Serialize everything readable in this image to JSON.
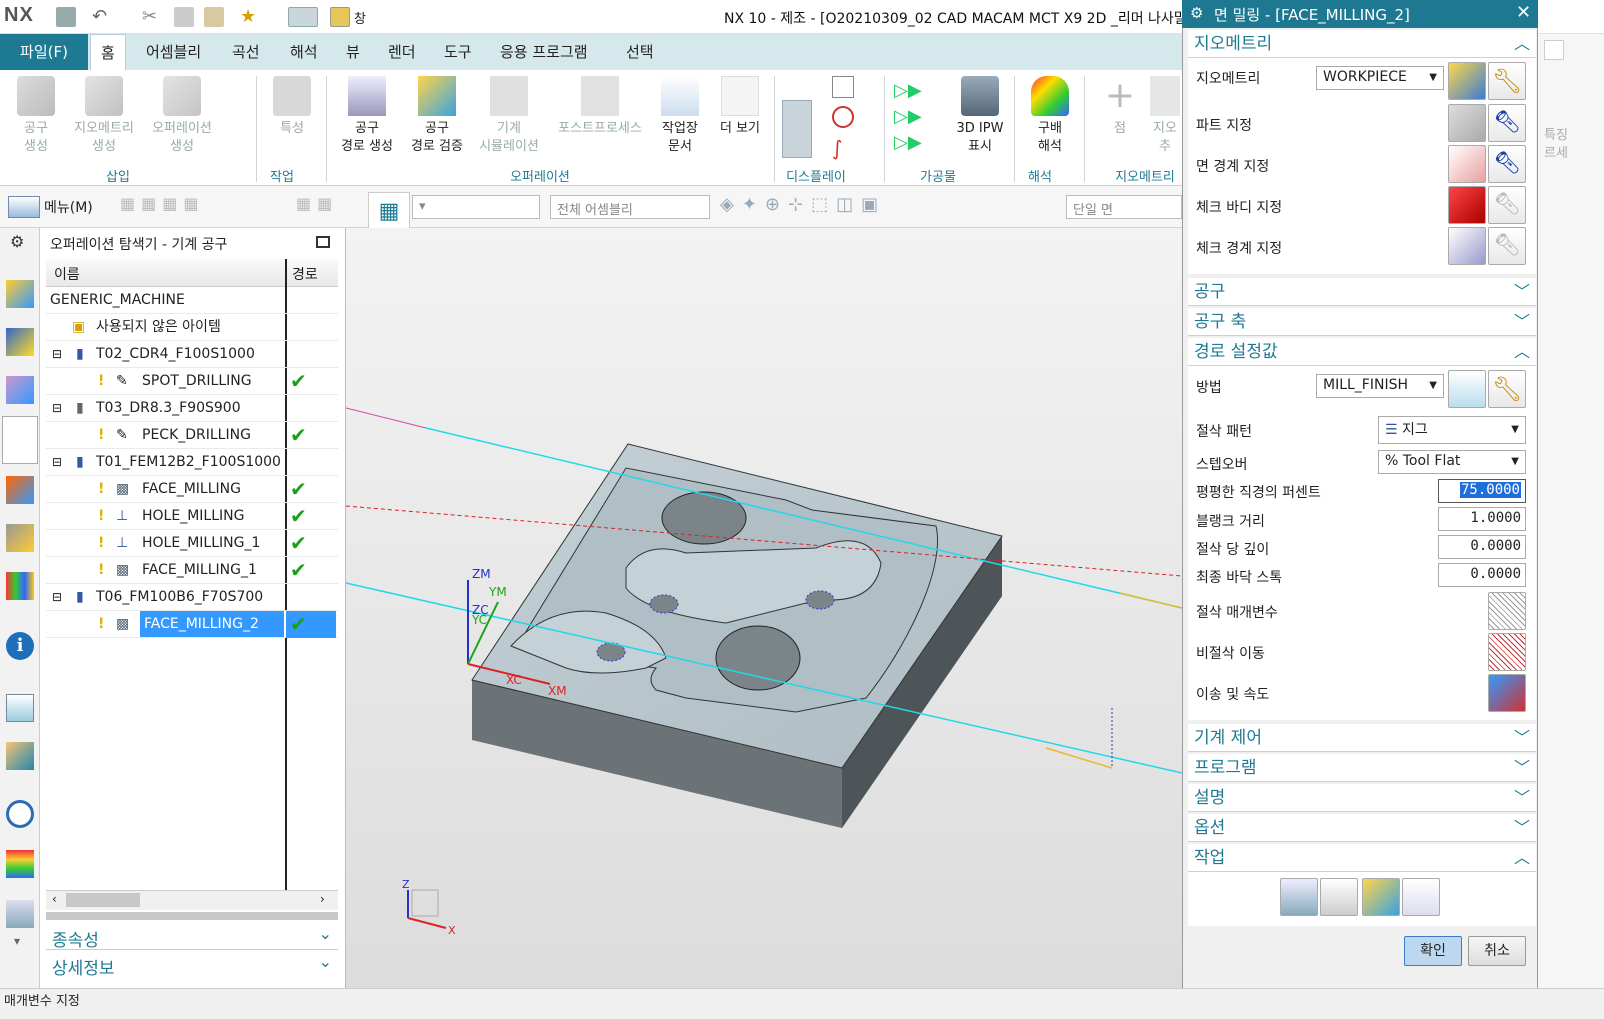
{
  "app": {
    "logo": "NX",
    "title": "NX 10 - 제조 - [O20210309_02 CAD MACAM MCT X9 2D _리머 나사밀",
    "window_menu": "창"
  },
  "tabs": [
    {
      "label": "파일(F)"
    },
    {
      "label": "홈"
    },
    {
      "label": "어셈블리"
    },
    {
      "label": "곡선"
    },
    {
      "label": "해석"
    },
    {
      "label": "뷰"
    },
    {
      "label": "렌더"
    },
    {
      "label": "도구"
    },
    {
      "label": "응용 프로그램"
    },
    {
      "label": "선택"
    }
  ],
  "ribbon": {
    "insert": [
      "공구\n생성",
      "지오메트리\n생성",
      "오퍼레이션\n생성"
    ],
    "job": [
      "특성"
    ],
    "operation": [
      "공구\n경로 생성",
      "공구\n경로 검증",
      "기계\n시뮬레이션",
      "포스트프로세스",
      "작업장\n문서",
      "더 보기"
    ],
    "extra": [
      "3D IPW\n표시",
      "구배\n해석",
      "점",
      "지오\n추"
    ],
    "groups": [
      "삽입",
      "작업",
      "오퍼레이션",
      "디스플레이",
      "가공물",
      "해석",
      "지오메트리",
      "특징"
    ]
  },
  "cmdbar": {
    "menu": "메뉴(M)",
    "assembly_filter": "전체 어셈블리",
    "face_rule": "단일 면"
  },
  "navigator": {
    "title": "오퍼레이션 탐색기 - 기계 공구",
    "col_name": "이름",
    "col_path": "경로",
    "rows": [
      {
        "text": "GENERIC_MACHINE",
        "check": ""
      },
      {
        "text": "사용되지 않은 아이템",
        "check": ""
      },
      {
        "text": "T02_CDR4_F100S1000",
        "check": ""
      },
      {
        "text": "SPOT_DRILLING",
        "check": "✔"
      },
      {
        "text": "T03_DR8.3_F90S900",
        "check": ""
      },
      {
        "text": "PECK_DRILLING",
        "check": "✔"
      },
      {
        "text": "T01_FEM12B2_F100S1000",
        "check": ""
      },
      {
        "text": "FACE_MILLING",
        "check": "✔"
      },
      {
        "text": "HOLE_MILLING",
        "check": "✔"
      },
      {
        "text": "HOLE_MILLING_1",
        "check": "✔"
      },
      {
        "text": "FACE_MILLING_1",
        "check": "✔"
      },
      {
        "text": "T06_FM100B6_F70S700",
        "check": ""
      },
      {
        "text": "FACE_MILLING_2",
        "check": "✔"
      }
    ],
    "bottom": [
      "종속성",
      "상세정보"
    ]
  },
  "viewport": {
    "axes": [
      "ZM",
      "YM",
      "ZC",
      "YC",
      "XC",
      "XM",
      "Z",
      "X"
    ]
  },
  "dialog": {
    "title": "면 밀링 - [FACE_MILLING_2]",
    "geometry_section": "지오메트리",
    "geometry_label": "지오메트리",
    "geometry_value": "WORKPIECE",
    "part": "파트 지정",
    "face_boundary": "면 경계 지정",
    "check_body": "체크 바디 지정",
    "check_boundary": "체크 경계 지정",
    "tool": "공구",
    "tool_axis": "공구 축",
    "path_settings": "경로 설정값",
    "method_label": "방법",
    "method_value": "MILL_FINISH",
    "cut_pattern_label": "절삭 패턴",
    "cut_pattern_value": "지그",
    "stepover_label": "스텝오버",
    "stepover_value": "% Tool Flat",
    "flat_pct_label": "평평한 직경의 퍼센트",
    "flat_pct_value": "75.0000",
    "blank_label": "블랭크 거리",
    "blank_value": "1.0000",
    "depth_label": "절삭 당 깊이",
    "depth_value": "0.0000",
    "floor_label": "최종 바닥 스톡",
    "floor_value": "0.0000",
    "cut_params": "절삭 매개변수",
    "noncut": "비절삭 이동",
    "feeds": "이송 및 속도",
    "machine_control": "기계 제어",
    "program": "프로그램",
    "description": "설명",
    "options": "옵션",
    "actions": "작업",
    "ok": "확인",
    "cancel": "취소"
  },
  "right_partial": {
    "label1": "특징",
    "label2": "르세"
  },
  "status": {
    "text": "매개변수 지정"
  },
  "colors": {
    "accent": "#1e7a93",
    "selection": "#3399ff",
    "check": "#1aa01a",
    "part_face": "#b8c6cc"
  }
}
